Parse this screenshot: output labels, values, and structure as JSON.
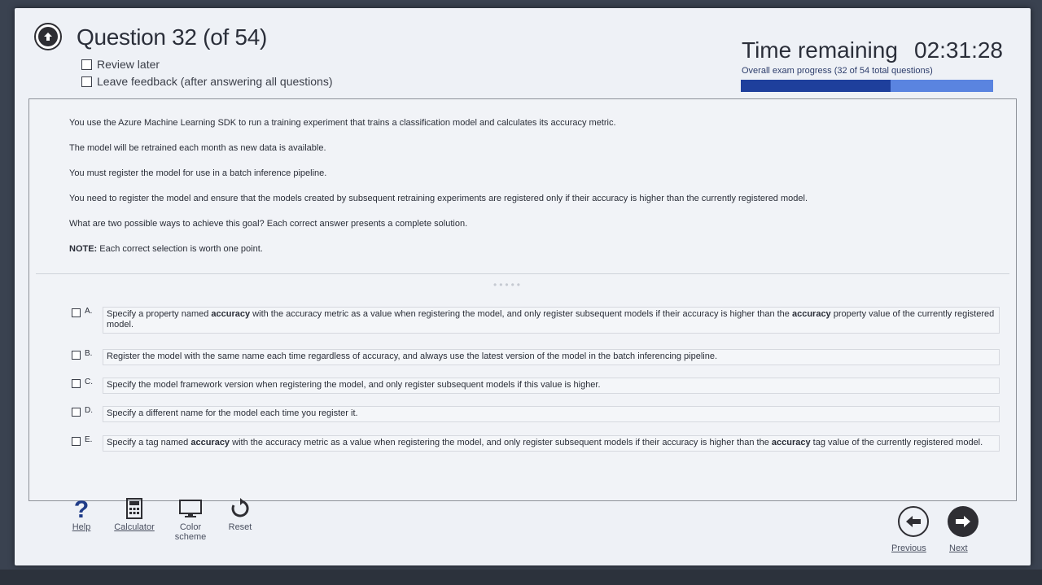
{
  "header": {
    "question_title": "Question 32 (of 54)",
    "review_later": "Review later",
    "leave_feedback": "Leave feedback (after answering all questions)"
  },
  "timer": {
    "label": "Time remaining",
    "value": "02:31:28",
    "progress_text": "Overall exam progress (32 of 54 total questions)",
    "progress_fraction": 0.5926,
    "accent_dark": "#1e3f9c",
    "accent_light": "#5a84e0"
  },
  "question": {
    "p1": "You use the Azure Machine Learning SDK to run a training experiment that trains a classification model and calculates its accuracy metric.",
    "p2": "The model will be retrained each month as new data is available.",
    "p3": "You must register the model for use in a batch inference pipeline.",
    "p4": "You need to register the model and ensure that the models created by subsequent retraining experiments are registered only if their accuracy is higher than the currently registered model.",
    "p5": "What are two possible ways to achieve this goal? Each correct answer presents a complete solution.",
    "note_label": "NOTE:",
    "note_text": " Each correct selection is worth one point."
  },
  "options": [
    {
      "letter": "A.",
      "t1": "Specify a property named ",
      "b1": "accuracy",
      "t2": " with the accuracy metric as a value when registering the model, and only register subsequent models if their accuracy is higher than the ",
      "b2": "accuracy",
      "t3": " property value of the currently registered model."
    },
    {
      "letter": "B.",
      "t1": "Register the model with the same name each time regardless of accuracy, and always use the latest version of the model in the batch inferencing pipeline."
    },
    {
      "letter": "C.",
      "t1": "Specify the model framework version when registering the model, and only register subsequent models if this value is higher."
    },
    {
      "letter": "D.",
      "t1": "Specify a different name for the model each time you register it."
    },
    {
      "letter": "E.",
      "t1": "Specify a tag named ",
      "b1": "accuracy",
      "t2": " with the accuracy metric as a value when registering the model, and only register subsequent models if their accuracy is higher than the ",
      "b2": "accuracy",
      "t3": " tag value of the currently registered model."
    }
  ],
  "toolbar": {
    "help": "Help",
    "calculator": "Calculator",
    "color_line1": "Color",
    "color_line2": "scheme",
    "reset": "Reset",
    "previous": "Previous",
    "next": "Next"
  }
}
